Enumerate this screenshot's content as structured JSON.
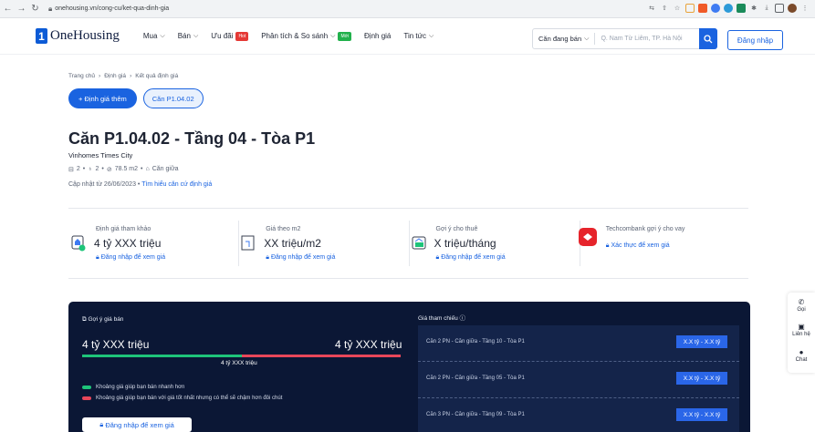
{
  "browser": {
    "url": "onehousing.vn/cong-cu/ket-qua-dinh-gia"
  },
  "header": {
    "logo": "OneHousing",
    "menu": [
      {
        "label": "Mua",
        "chevron": true
      },
      {
        "label": "Bán",
        "chevron": true
      },
      {
        "label": "Ưu đãi",
        "badge": "Hot",
        "badge_color": "#e53935"
      },
      {
        "label": "Phân tích & So sánh",
        "chevron": true,
        "badge": "Mới",
        "badge_color": "#22b14c"
      },
      {
        "label": "Định giá"
      },
      {
        "label": "Tin tức",
        "chevron": true
      }
    ],
    "search_category": "Căn đang bán",
    "search_placeholder": "Q. Nam Từ Liêm, TP. Hà Nội",
    "login": "Đăng nhập"
  },
  "breadcrumb": [
    "Trang chủ",
    "Định giá",
    "Kết quả định giá"
  ],
  "actions": {
    "primary": "+ Định giá thêm",
    "secondary": "Căn P1.04.02"
  },
  "property": {
    "title": "Căn P1.04.02 - Tầng 04 - Tòa P1",
    "project": "Vinhomes Times City",
    "bedrooms": "2",
    "bathrooms": "2",
    "area": "78.5 m2",
    "position": "Căn giữa",
    "updated_prefix": "Cập nhật từ 26/06/2023",
    "updated_link": "Tìm hiểu căn cứ định giá"
  },
  "stats": [
    {
      "label": "Định giá tham khảo",
      "value": "4 tỷ XXX triệu",
      "link": "Đăng nhập để xem giá",
      "icon": "house-check-icon"
    },
    {
      "label": "Giá theo m2",
      "value": "XX triệu/m2",
      "link": "Đăng nhập để xem giá",
      "icon": "floorplan-icon"
    },
    {
      "label": "Gợi ý cho thuê",
      "value": "X triệu/tháng",
      "link": "Đăng nhập để xem giá",
      "icon": "rent-icon"
    },
    {
      "label": "Techcombank gợi ý cho vay",
      "value": "",
      "link": "Xác thực để xem giá",
      "icon": "techcombank-icon"
    }
  ],
  "panel": {
    "title": "Gợi ý giá bán",
    "low": "4 tỷ XXX triệu",
    "high": "4 tỷ XXX triệu",
    "mid": "4 tỷ XXX triệu",
    "legend_green": "Khoảng giá giúp bạn bán nhanh hơn",
    "legend_red": "Khoảng giá giúp bạn bán với giá tốt nhất nhưng có thể sẽ chậm hơn đôi chút",
    "login_button": "Đăng nhập để xem giá",
    "green": "#1ec47a",
    "red": "#e8475a"
  },
  "reference": {
    "title": "Giá tham chiếu",
    "rows": [
      {
        "name": "Căn 2 PN - Căn giữa - Tầng 10 - Tòa P1",
        "price": "X.X tỷ - X.X tỷ"
      },
      {
        "name": "Căn 2 PN - Căn giữa - Tầng 05 - Tòa P1",
        "price": "X.X tỷ - X.X tỷ"
      },
      {
        "name": "Căn 3 PN - Căn giữa - Tầng 09 - Tòa P1",
        "price": "X.X tỷ - X.X tỷ"
      }
    ]
  },
  "side": [
    {
      "label": "Gọi",
      "icon": "phone-icon"
    },
    {
      "label": "Liên hệ",
      "icon": "contact-icon"
    },
    {
      "label": "Chat",
      "icon": "chat-icon"
    }
  ],
  "colors": {
    "accent": "#1a63e0",
    "panel_bg": "#0b1735"
  }
}
